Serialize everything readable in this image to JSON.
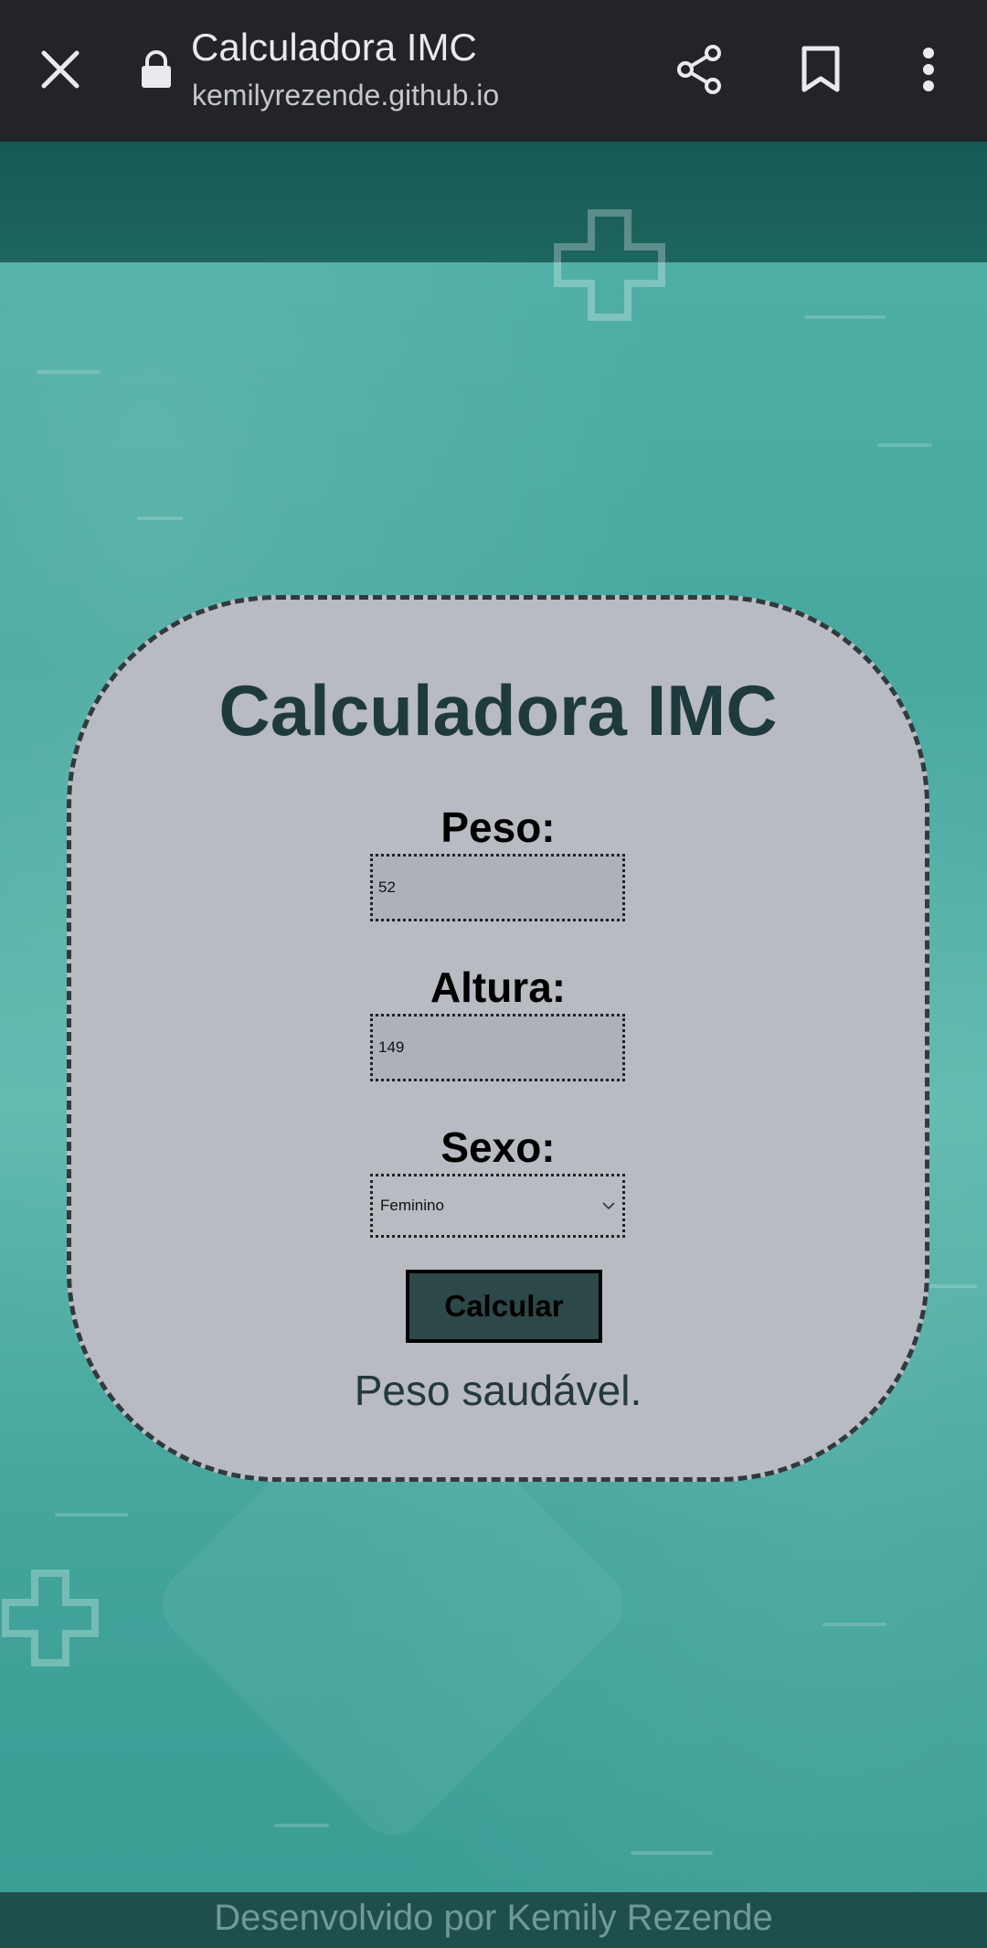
{
  "browser": {
    "title": "Calculadora IMC",
    "url": "kemilyrezende.github.io",
    "icons": {
      "close": "close-icon",
      "lock": "lock-icon",
      "share": "share-icon",
      "bookmark": "bookmark-icon",
      "menu": "more-vert-icon"
    }
  },
  "card": {
    "title": "Calculadora IMC",
    "peso": {
      "label": "Peso:",
      "value": "52"
    },
    "altura": {
      "label": "Altura:",
      "value": "149"
    },
    "sexo": {
      "label": "Sexo:",
      "selected": "Feminino"
    },
    "button_label": "Calcular",
    "result": "Peso saudável."
  },
  "footer": {
    "text": "Desenvolvido por Kemily Rezende"
  },
  "colors": {
    "browser_bar": "#232427",
    "header_band": "#175953",
    "page_teal": "#47a89f",
    "card_bg": "#b8bbc1",
    "card_title": "#1f3a3c",
    "button_bg": "#2d4848",
    "footer_bg": "#1f4f4c"
  }
}
